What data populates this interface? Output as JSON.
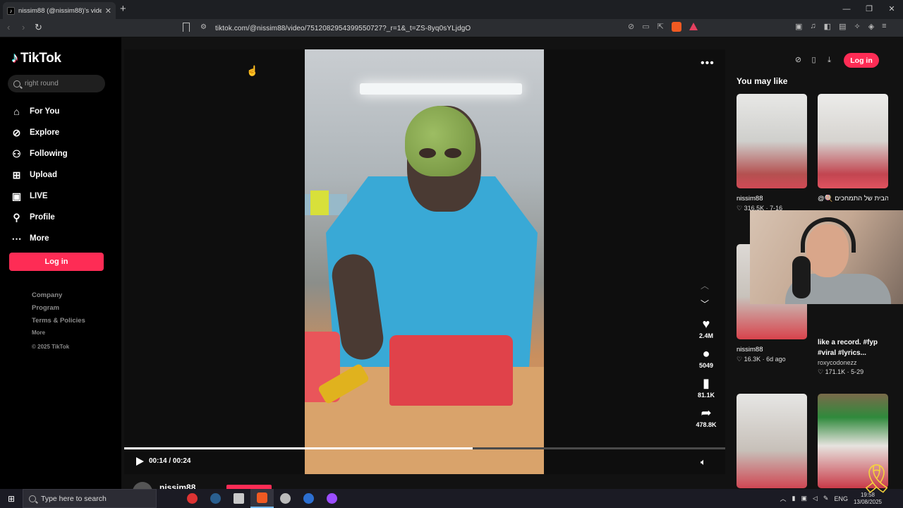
{
  "browser": {
    "tab_title": "nissim88 (@nissim88)'s video",
    "tab_close": "✕",
    "new_tab": "+",
    "url": "tiktok.com/@nissim88/video/7512082954399550727?_r=1&_t=ZS-8yq0sYLjdgO",
    "window_controls": [
      "—",
      "❐",
      "✕"
    ]
  },
  "sidebar": {
    "logo_text": "TikTok",
    "search_placeholder": "right round",
    "nav_items": [
      {
        "label": "For You",
        "icon": "home-icon"
      },
      {
        "label": "Explore",
        "icon": "compass-icon"
      },
      {
        "label": "Following",
        "icon": "following-icon"
      },
      {
        "label": "Upload",
        "icon": "upload-icon"
      },
      {
        "label": "LIVE",
        "icon": "live-icon"
      },
      {
        "label": "Profile",
        "icon": "profile-icon"
      },
      {
        "label": "More",
        "icon": "more-icon"
      }
    ],
    "login_label": "Log in",
    "footer": {
      "company": "Company",
      "program": "Program",
      "terms": "Terms & Policies",
      "more": "More",
      "copyright": "© 2025 TikTok"
    }
  },
  "video": {
    "time": "00:14 / 00:24",
    "progress_fraction": 0.58,
    "author": "nissim88",
    "likes": "2.4M",
    "comments": "5049",
    "saves": "81.1K",
    "shares": "478.8K"
  },
  "right": {
    "login_label": "Log in",
    "you_may_like": "You may like",
    "cards": [
      {
        "name": "nissim88",
        "meta": "♡ 316.5K · 7-16"
      },
      {
        "name": "@🍭 סטה הבית של התמחכים🍭",
        "meta": ""
      },
      {
        "name": "nissim88",
        "meta": "♡ 16.3K · 6d ago"
      },
      {
        "title": "like a record. #fyp #viral #lyrics...",
        "author": "roxycodonezz",
        "meta": "♡ 171.1K · 5-29"
      }
    ]
  },
  "taskbar": {
    "search_placeholder": "Type here to search",
    "lang": "ENG",
    "time": "19:58",
    "date": "13/08/2025"
  },
  "colors": {
    "accent": "#fe2c55",
    "page_bg": "#121212",
    "sidebar_bg": "#000000"
  }
}
